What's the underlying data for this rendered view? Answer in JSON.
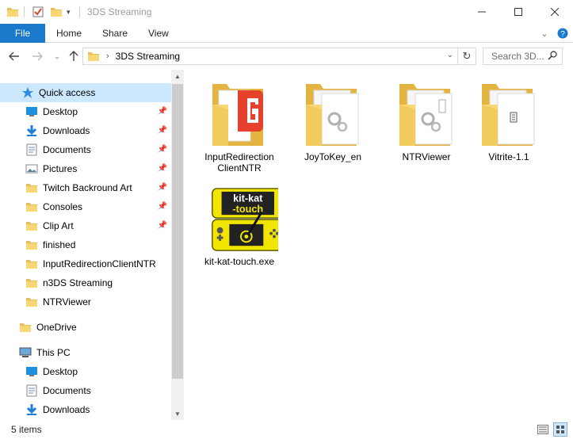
{
  "window": {
    "title": "3DS Streaming",
    "accent": "#1979ca",
    "controls": [
      "minimize-icon",
      "maximize-icon",
      "close-icon"
    ]
  },
  "ribbon": {
    "tabs": [
      "File",
      "Home",
      "Share",
      "View"
    ]
  },
  "address": {
    "path_label": "3DS Streaming",
    "search_placeholder": "Search 3D..."
  },
  "nav": {
    "quick_access": "Quick access",
    "items": [
      {
        "label": "Desktop",
        "icon": "desktop-icon",
        "pinned": true
      },
      {
        "label": "Downloads",
        "icon": "download-arrow-icon",
        "pinned": true
      },
      {
        "label": "Documents",
        "icon": "documents-icon",
        "pinned": true
      },
      {
        "label": "Pictures",
        "icon": "pictures-icon",
        "pinned": true
      },
      {
        "label": "Twitch Backround Art",
        "icon": "folder-icon",
        "pinned": true
      },
      {
        "label": "Consoles",
        "icon": "folder-icon",
        "pinned": true
      },
      {
        "label": "Clip Art",
        "icon": "folder-icon",
        "pinned": true
      },
      {
        "label": "finished",
        "icon": "folder-icon",
        "pinned": false
      },
      {
        "label": "InputRedirectionClientNTR",
        "icon": "folder-icon",
        "pinned": false
      },
      {
        "label": "n3DS Streaming",
        "icon": "folder-icon",
        "pinned": false
      },
      {
        "label": "NTRViewer",
        "icon": "folder-icon",
        "pinned": false
      }
    ],
    "onedrive": "OneDrive",
    "this_pc": "This PC",
    "pc_items": [
      {
        "label": "Desktop",
        "icon": "desktop-icon"
      },
      {
        "label": "Documents",
        "icon": "documents-icon"
      },
      {
        "label": "Downloads",
        "icon": "download-arrow-icon"
      }
    ]
  },
  "files": [
    {
      "name_line1": "InputRedirection",
      "name_line2": "ClientNTR",
      "type": "folder-with-logo"
    },
    {
      "name_line1": "JoyToKey_en",
      "name_line2": "",
      "type": "folder-with-gears"
    },
    {
      "name_line1": "NTRViewer",
      "name_line2": "",
      "type": "folder-with-gears"
    },
    {
      "name_line1": "Vitrite-1.1",
      "name_line2": "",
      "type": "folder-with-doc"
    },
    {
      "name_line1": "kit-kat-touch.exe",
      "name_line2": "",
      "type": "exe-3ds",
      "logo_line1": "kit-kat",
      "logo_line2": "-touch"
    }
  ],
  "status": {
    "item_count": "5 items"
  }
}
